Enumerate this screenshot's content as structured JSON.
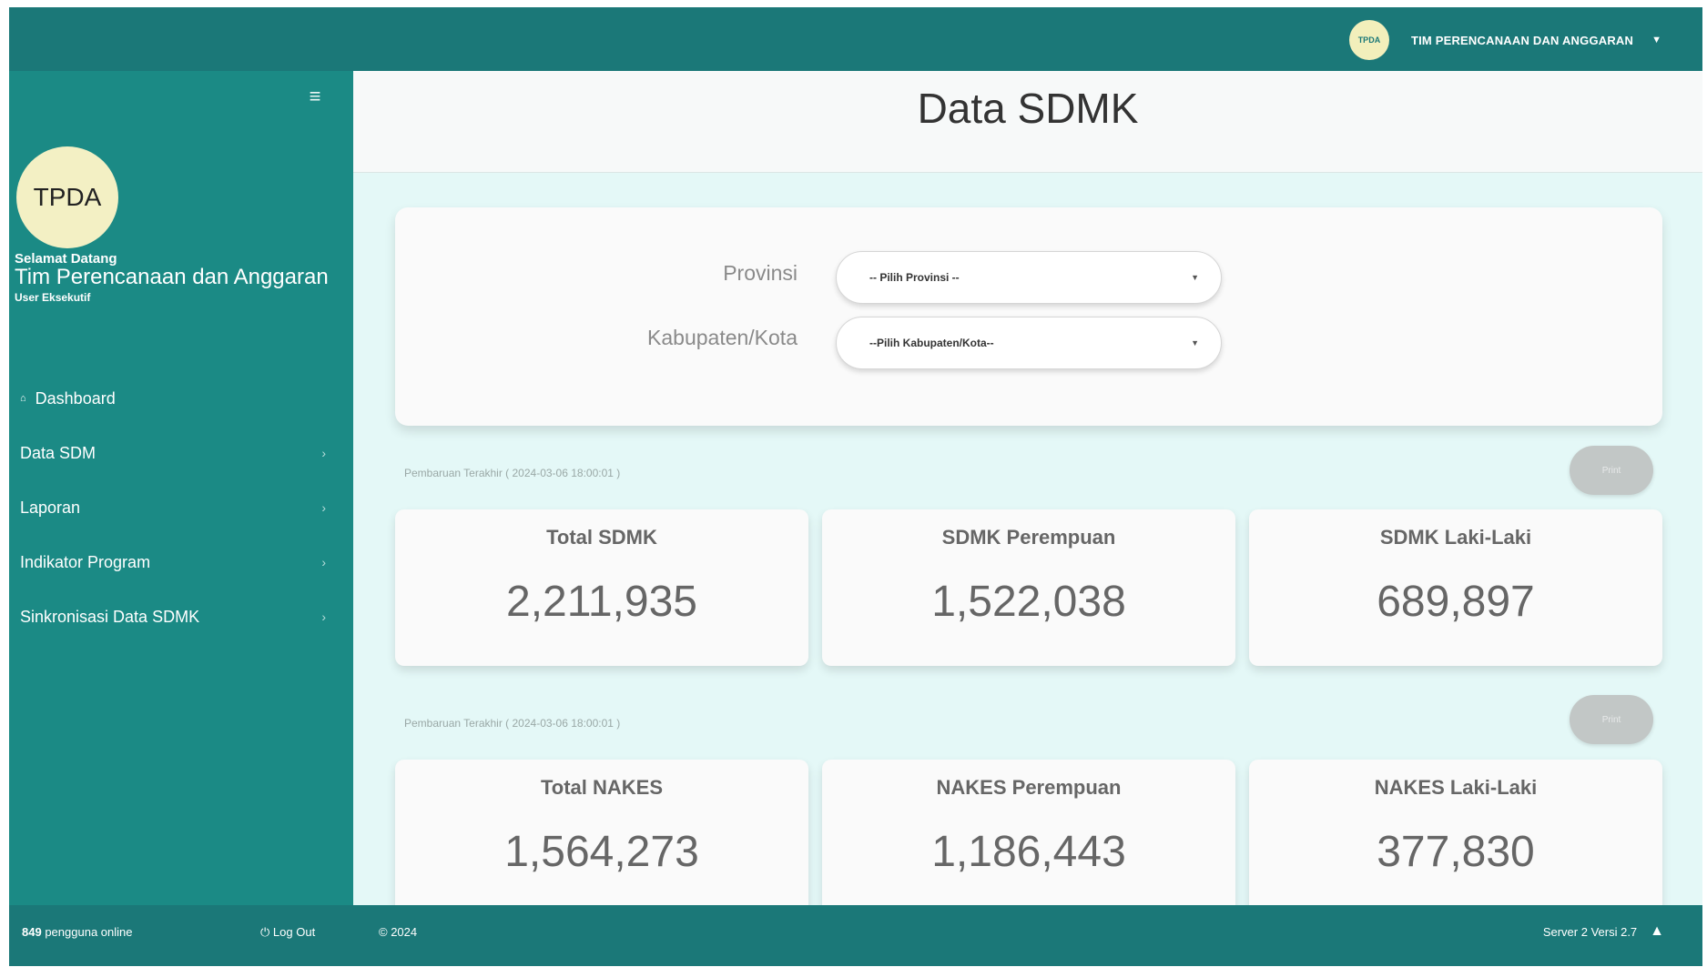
{
  "topbar": {
    "avatar_text": "TPDA",
    "user_name": "TIM PERENCANAAN DAN ANGGARAN",
    "caret": "▼"
  },
  "sidebar": {
    "menu_icon": "hamburger-icon",
    "avatar_text": "TPDA",
    "welcome": "Selamat Datang",
    "org_name": "Tim Perencanaan dan Anggaran",
    "role": "User Eksekutif",
    "items": [
      {
        "label": "Dashboard",
        "icon": "dashboard-icon",
        "icon_glyph": "⌂"
      },
      {
        "label": "Data SDM",
        "chevron": "›"
      },
      {
        "label": "Laporan",
        "chevron": "›"
      },
      {
        "label": "Indikator Program",
        "chevron": "›"
      },
      {
        "label": "Sinkronisasi Data SDMK",
        "chevron": "›"
      }
    ]
  },
  "main": {
    "page_title": "Data SDMK",
    "filters": {
      "provinsi_label": "Provinsi",
      "provinsi_value": "-- Pilih Provinsi --",
      "kabkota_label": "Kabupaten/Kota",
      "kabkota_value": "--Pilih Kabupaten/Kota--"
    },
    "sections": [
      {
        "update_text": "Pembaruan Terakhir ( 2024-03-06 18:00:01 )",
        "button_label": "Print",
        "cards": [
          {
            "label": "Total SDMK",
            "value": "2,211,935"
          },
          {
            "label": "SDMK Perempuan",
            "value": "1,522,038"
          },
          {
            "label": "SDMK Laki-Laki",
            "value": "689,897"
          }
        ]
      },
      {
        "update_text": "Pembaruan Terakhir ( 2024-03-06 18:00:01 )",
        "button_label": "Print",
        "cards": [
          {
            "label": "Total NAKES",
            "value": "1,564,273"
          },
          {
            "label": "NAKES Perempuan",
            "value": "1,186,443"
          },
          {
            "label": "NAKES Laki-Laki",
            "value": "377,830"
          }
        ]
      }
    ]
  },
  "footer": {
    "online_count": "849",
    "online_text": "pengguna online",
    "logout": "Log Out",
    "copyright": "© 2024",
    "server": "Server 2 Versi 2.7"
  },
  "colors": {
    "topbar": "#1b7878",
    "sidebar": "#1b8a85",
    "main_bg": "#e4f8f7",
    "avatar": "#f2efbb"
  }
}
